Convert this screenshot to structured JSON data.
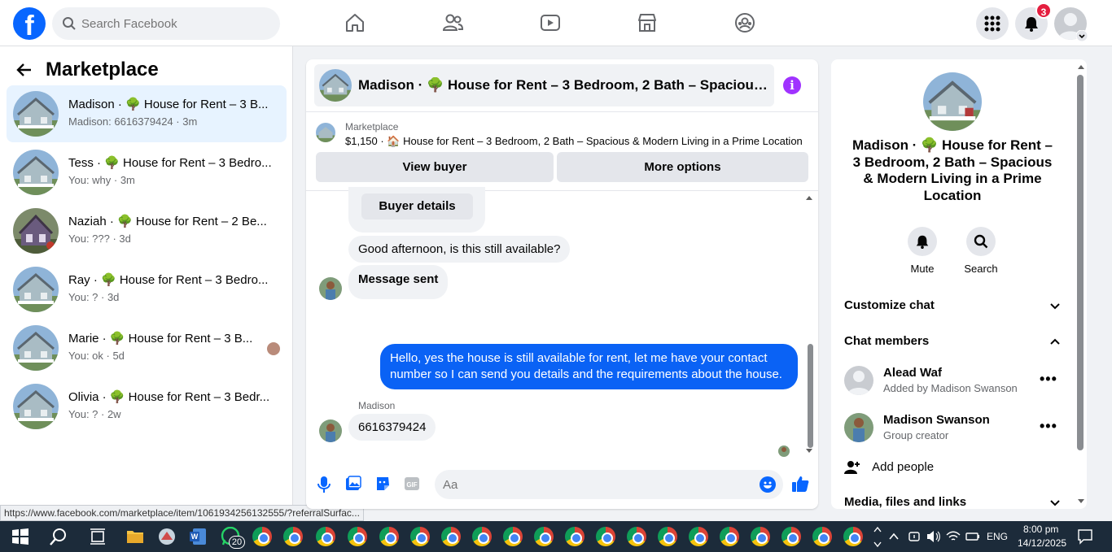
{
  "topbar": {
    "search_placeholder": "Search Facebook",
    "notifications_count": "3",
    "icons": [
      "home-icon",
      "friends-icon",
      "watch-icon",
      "marketplace-icon",
      "groups-icon",
      "menu-grid-icon",
      "bell-icon"
    ]
  },
  "left": {
    "title": "Marketplace",
    "conversations": [
      {
        "title": "Madison · 🌳 House for Rent – 3 B...",
        "sub": "Madison: 6616379424 · 3m"
      },
      {
        "title": "Tess · 🌳 House for Rent – 3 Bedro...",
        "sub": "You: why · 3m"
      },
      {
        "title": "Naziah · 🌳 House for Rent – 2 Be...",
        "sub": "You: ??? · 3d"
      },
      {
        "title": "Ray · 🌳 House for Rent – 3 Bedro...",
        "sub": "You: ? · 3d"
      },
      {
        "title": "Marie · 🌳 House for Rent – 3 B...",
        "sub": "You: ok · 5d"
      },
      {
        "title": "Olivia · 🌳 House for Rent – 3 Bedr...",
        "sub": "You: ? · 2w"
      }
    ]
  },
  "status_url": "https://www.facebook.com/marketplace/item/1061934256132555/?referralSurfac...",
  "chat": {
    "header_title": "Madison · 🌳 House for Rent – 3 Bedroom, 2 Bath – Spacious & Modern Living in a Prime Location",
    "marketplace_label": "Marketplace",
    "listing_line": "$1,150 · 🏠 House for Rent – 3 Bedroom, 2 Bath – Spacious & Modern Living in a Prime Location",
    "view_buyer": "View buyer",
    "more_options": "More options",
    "buyer_details": "Buyer details",
    "msg1": "Good afternoon, is this still available?",
    "msg2": "Message sent",
    "msg3": "Hello, yes the house is still available for rent, let me have your contact number so I can send you details and the requirements about the house.",
    "sender_name": "Madison",
    "msg4": "6616379424",
    "composer_placeholder": "Aa"
  },
  "right": {
    "title": "Madison · 🌳 House for Rent – 3 Bedroom, 2 Bath – Spacious & Modern Living in a Prime Location",
    "mute": "Mute",
    "search": "Search",
    "customize_chat": "Customize chat",
    "chat_members": "Chat members",
    "members": [
      {
        "name": "Alead Waf",
        "role": "Added by Madison Swanson"
      },
      {
        "name": "Madison Swanson",
        "role": "Group creator"
      }
    ],
    "add_people": "Add people",
    "media": "Media, files and links"
  },
  "taskbar": {
    "whatsapp_badge": "20",
    "lang": "ENG",
    "time": "8:00 pm",
    "date": "14/12/2025"
  }
}
